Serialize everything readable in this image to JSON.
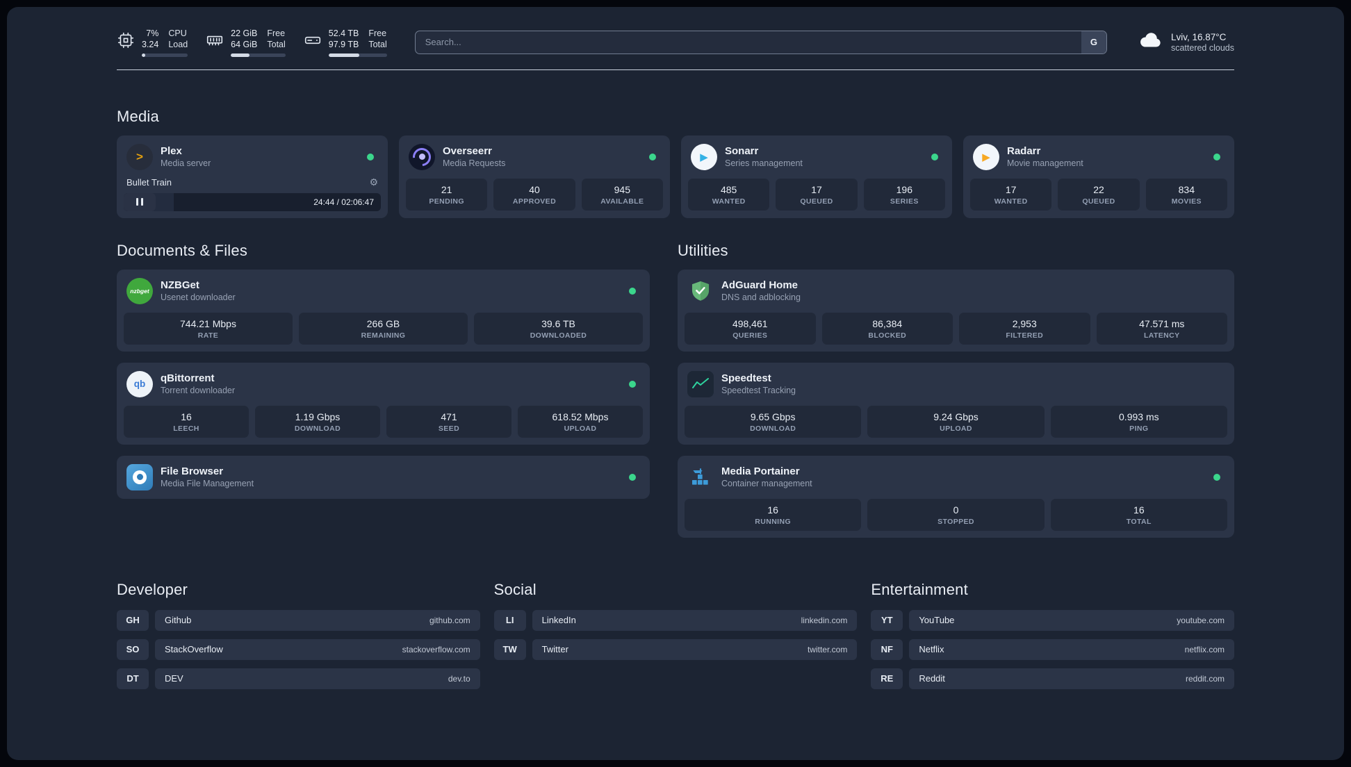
{
  "topbar": {
    "cpu": {
      "value_top": "7%",
      "value_bottom": "3.24",
      "label_top": "CPU",
      "label_bottom": "Load",
      "percent": 7
    },
    "memory": {
      "value_top": "22 GiB",
      "value_bottom": "64 GiB",
      "label_top": "Free",
      "label_bottom": "Total",
      "percent": 34
    },
    "disk": {
      "value_top": "52.4 TB",
      "value_bottom": "97.9 TB",
      "label_top": "Free",
      "label_bottom": "Total",
      "percent": 53
    },
    "search": {
      "placeholder": "Search...",
      "provider_label": "G"
    },
    "weather": {
      "location": "Lviv, 16.87°C",
      "condition": "scattered clouds"
    }
  },
  "media": {
    "title": "Media",
    "plex": {
      "name": "Plex",
      "desc": "Media server",
      "now_playing": "Bullet Train",
      "time": "24:44 / 02:06:47",
      "progress_percent": 19.5,
      "gear": "⚙"
    },
    "overseerr": {
      "name": "Overseerr",
      "desc": "Media Requests",
      "stats": [
        {
          "value": "21",
          "label": "PENDING"
        },
        {
          "value": "40",
          "label": "APPROVED"
        },
        {
          "value": "945",
          "label": "AVAILABLE"
        }
      ]
    },
    "sonarr": {
      "name": "Sonarr",
      "desc": "Series management",
      "stats": [
        {
          "value": "485",
          "label": "WANTED"
        },
        {
          "value": "17",
          "label": "QUEUED"
        },
        {
          "value": "196",
          "label": "SERIES"
        }
      ]
    },
    "radarr": {
      "name": "Radarr",
      "desc": "Movie management",
      "stats": [
        {
          "value": "17",
          "label": "WANTED"
        },
        {
          "value": "22",
          "label": "QUEUED"
        },
        {
          "value": "834",
          "label": "MOVIES"
        }
      ]
    }
  },
  "documents": {
    "title": "Documents & Files",
    "nzbget": {
      "name": "NZBGet",
      "desc": "Usenet downloader",
      "stats": [
        {
          "value": "744.21 Mbps",
          "label": "RATE"
        },
        {
          "value": "266 GB",
          "label": "REMAINING"
        },
        {
          "value": "39.6 TB",
          "label": "DOWNLOADED"
        }
      ]
    },
    "qbittorrent": {
      "name": "qBittorrent",
      "desc": "Torrent downloader",
      "stats": [
        {
          "value": "16",
          "label": "LEECH"
        },
        {
          "value": "1.19 Gbps",
          "label": "DOWNLOAD"
        },
        {
          "value": "471",
          "label": "SEED"
        },
        {
          "value": "618.52 Mbps",
          "label": "UPLOAD"
        }
      ]
    },
    "filebrowser": {
      "name": "File Browser",
      "desc": "Media File Management"
    }
  },
  "utilities": {
    "title": "Utilities",
    "adguard": {
      "name": "AdGuard Home",
      "desc": "DNS and adblocking",
      "stats": [
        {
          "value": "498,461",
          "label": "QUERIES"
        },
        {
          "value": "86,384",
          "label": "BLOCKED"
        },
        {
          "value": "2,953",
          "label": "FILTERED"
        },
        {
          "value": "47.571 ms",
          "label": "LATENCY"
        }
      ]
    },
    "speedtest": {
      "name": "Speedtest",
      "desc": "Speedtest Tracking",
      "stats": [
        {
          "value": "9.65 Gbps",
          "label": "DOWNLOAD"
        },
        {
          "value": "9.24 Gbps",
          "label": "UPLOAD"
        },
        {
          "value": "0.993 ms",
          "label": "PING"
        }
      ]
    },
    "portainer": {
      "name": "Media Portainer",
      "desc": "Container management",
      "stats": [
        {
          "value": "16",
          "label": "RUNNING"
        },
        {
          "value": "0",
          "label": "STOPPED"
        },
        {
          "value": "16",
          "label": "TOTAL"
        }
      ]
    }
  },
  "bookmarks": {
    "developer": {
      "title": "Developer",
      "items": [
        {
          "abbr": "GH",
          "name": "Github",
          "url": "github.com"
        },
        {
          "abbr": "SO",
          "name": "StackOverflow",
          "url": "stackoverflow.com"
        },
        {
          "abbr": "DT",
          "name": "DEV",
          "url": "dev.to"
        }
      ]
    },
    "social": {
      "title": "Social",
      "items": [
        {
          "abbr": "LI",
          "name": "LinkedIn",
          "url": "linkedin.com"
        },
        {
          "abbr": "TW",
          "name": "Twitter",
          "url": "twitter.com"
        }
      ]
    },
    "entertainment": {
      "title": "Entertainment",
      "items": [
        {
          "abbr": "YT",
          "name": "YouTube",
          "url": "youtube.com"
        },
        {
          "abbr": "NF",
          "name": "Netflix",
          "url": "netflix.com"
        },
        {
          "abbr": "RE",
          "name": "Reddit",
          "url": "reddit.com"
        }
      ]
    }
  },
  "icons": {
    "nzbget_text": "nzbget",
    "qb_text": "qb",
    "plex_chevron": ">",
    "play": "▶"
  }
}
